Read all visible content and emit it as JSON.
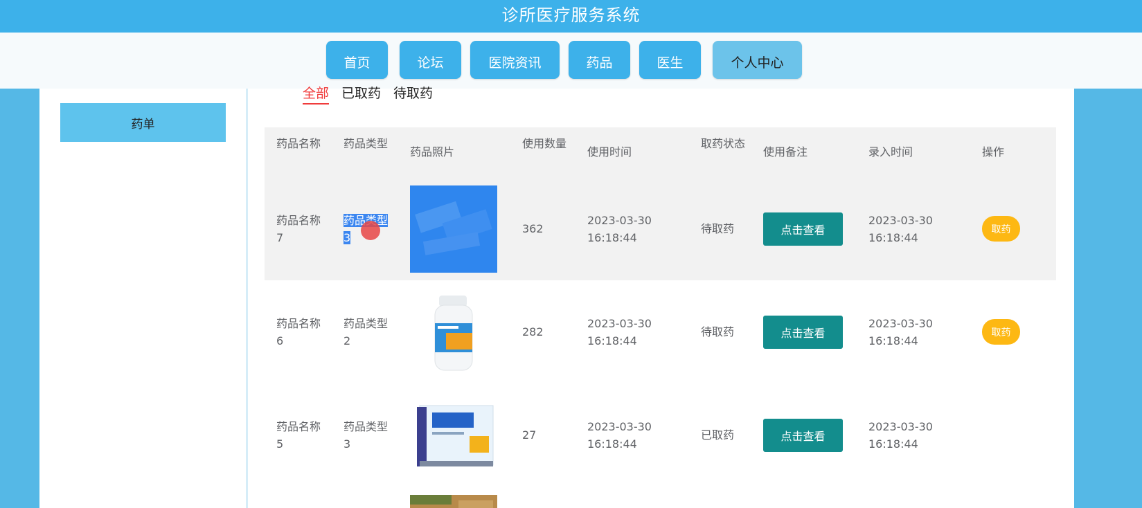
{
  "header": {
    "title": "诊所医疗服务系统"
  },
  "nav": {
    "items": [
      {
        "label": "首页"
      },
      {
        "label": "论坛"
      },
      {
        "label": "医院资讯"
      },
      {
        "label": "药品"
      },
      {
        "label": "医生"
      },
      {
        "label": "个人中心"
      }
    ],
    "active_index": 5
  },
  "sidebar": {
    "active_item": "药单"
  },
  "tabs": [
    {
      "label": "全部",
      "active": true
    },
    {
      "label": "已取药",
      "active": false
    },
    {
      "label": "待取药",
      "active": false
    }
  ],
  "table": {
    "headers": [
      "药品名称",
      "药品类型",
      "药品照片",
      "使用数量",
      "使用时间",
      "取药状态",
      "使用备注",
      "录入时间",
      "操作"
    ],
    "rows": [
      {
        "name": "药品名称7",
        "type": "药品类型3",
        "qty": "362",
        "use_date": "2023-03-30",
        "use_time": "16:18:44",
        "status": "待取药",
        "remark_btn": "点击查看",
        "entry_date": "2023-03-30",
        "entry_time": "16:18:44",
        "action": "取药"
      },
      {
        "name": "药品名称6",
        "type": "药品类型2",
        "qty": "282",
        "use_date": "2023-03-30",
        "use_time": "16:18:44",
        "status": "待取药",
        "remark_btn": "点击查看",
        "entry_date": "2023-03-30",
        "entry_time": "16:18:44",
        "action": "取药"
      },
      {
        "name": "药品名称5",
        "type": "药品类型3",
        "qty": "27",
        "use_date": "2023-03-30",
        "use_time": "16:18:44",
        "status": "已取药",
        "remark_btn": "点击查看",
        "entry_date": "2023-03-30",
        "entry_time": "16:18:44",
        "action": ""
      }
    ]
  },
  "colors": {
    "primary": "#3db1ea",
    "view_button": "#138d8d",
    "take_button": "#fdb813",
    "tab_active": "#f03c3c"
  }
}
